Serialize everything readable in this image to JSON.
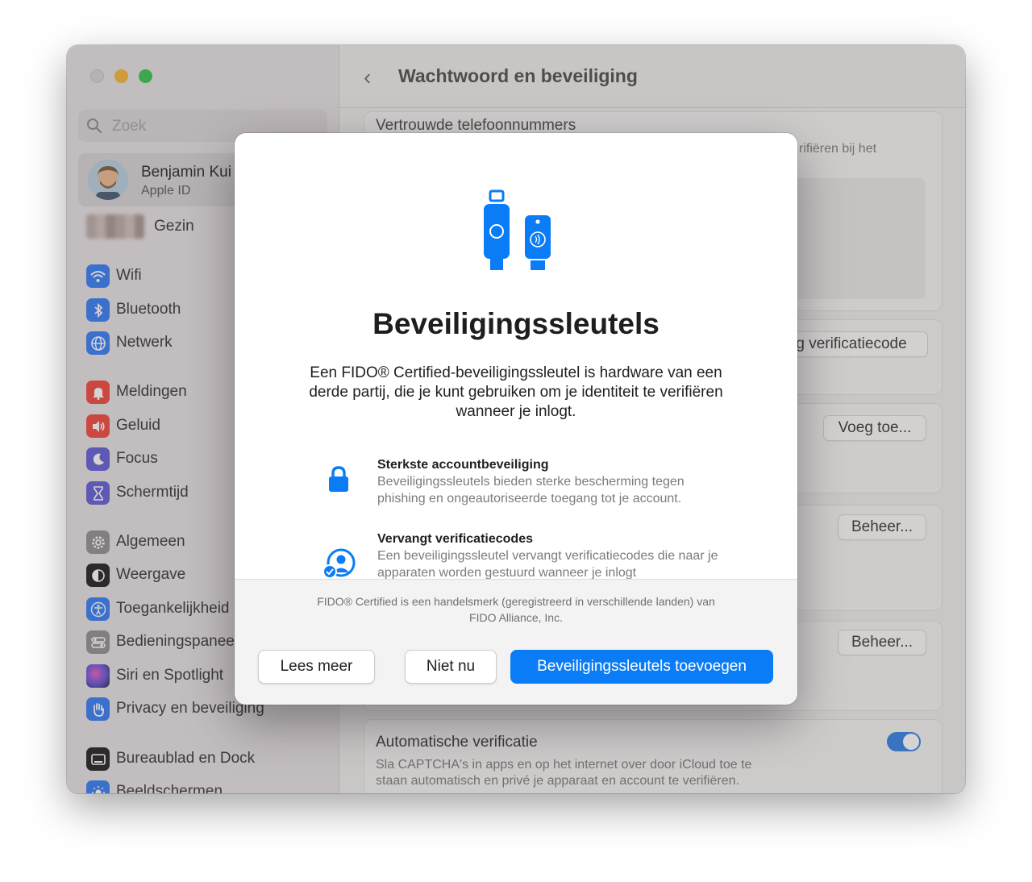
{
  "window": {
    "sidebar": {
      "search_placeholder": "Zoek",
      "profile": {
        "name": "Benjamin Kui",
        "subtitle": "Apple ID"
      },
      "family_label": "Gezin",
      "items": [
        {
          "label": "Wifi",
          "icon": "wifi-icon",
          "color": "#2e7bf6"
        },
        {
          "label": "Bluetooth",
          "icon": "bluetooth-icon",
          "color": "#2e7bf6"
        },
        {
          "label": "Netwerk",
          "icon": "globe-icon",
          "color": "#2e7bf6"
        },
        {
          "label": "Meldingen",
          "icon": "bell-icon",
          "color": "#f0443a"
        },
        {
          "label": "Geluid",
          "icon": "speaker-icon",
          "color": "#f0443a"
        },
        {
          "label": "Focus",
          "icon": "moon-icon",
          "color": "#5e5bd6"
        },
        {
          "label": "Schermtijd",
          "icon": "hourglass-icon",
          "color": "#5e5bd6"
        },
        {
          "label": "Algemeen",
          "icon": "gear-icon",
          "color": "#8e8e93"
        },
        {
          "label": "Weergave",
          "icon": "appearance-icon",
          "color": "#1c1c1e"
        },
        {
          "label": "Toegankelijkheid",
          "icon": "accessibility-icon",
          "color": "#2e7bf6"
        },
        {
          "label": "Bedieningspaneel",
          "icon": "control-center-icon",
          "color": "#8e8e93"
        },
        {
          "label": "Siri en Spotlight",
          "icon": "siri-icon",
          "color": "#b84ad6"
        },
        {
          "label": "Privacy en beveiliging",
          "icon": "hand-icon",
          "color": "#2e7bf6"
        },
        {
          "label": "Bureaublad en Dock",
          "icon": "dock-icon",
          "color": "#1c1c1e"
        },
        {
          "label": "Beeldschermen",
          "icon": "sun-icon",
          "color": "#2e7bf6"
        }
      ]
    },
    "main": {
      "back_symbol": "‹",
      "title": "Wachtwoord en beveiliging",
      "trusted_numbers_heading": "Vertrouwde telefoonnummers",
      "verify_fragment": "rifiëren bij het",
      "verification_code_button": "g verificatiecode",
      "add_button": "Voeg toe...",
      "manage_button_1": "Beheer...",
      "manage_button_2": "Beheer...",
      "auto_verify_title": "Automatische verificatie",
      "auto_verify_desc_1": "Sla CAPTCHA's in apps en op het internet over door iCloud toe te",
      "auto_verify_desc_2": "staan automatisch en privé je apparaat en account te verifiëren.",
      "auto_verify_enabled": true
    }
  },
  "dialog": {
    "title": "Beveiligingssleutels",
    "description": "Een FIDO® Certified-beveiligingssleutel is hardware van een derde partij, die je kunt gebruiken om je identiteit te verifiëren wanneer je inlogt.",
    "features": [
      {
        "icon": "lock-icon",
        "title": "Sterkste accountbeveiliging",
        "text": "Beveiligingssleutels bieden sterke bescherming tegen phishing en ongeautoriseerde toegang tot je account."
      },
      {
        "icon": "person-check-icon",
        "title": "Vervangt verificatiecodes",
        "text": "Een beveiligingssleutel vervangt verificatiecodes die naar je apparaten worden gestuurd wanneer je inlogt"
      }
    ],
    "footnote": "FIDO® Certified is een handelsmerk (geregistreerd in verschillende landen) van FIDO Alliance, Inc.",
    "buttons": {
      "learn_more": "Lees meer",
      "not_now": "Niet nu",
      "add_keys": "Beveiligingssleutels toevoegen"
    },
    "accent_color": "#0a7cf5"
  }
}
